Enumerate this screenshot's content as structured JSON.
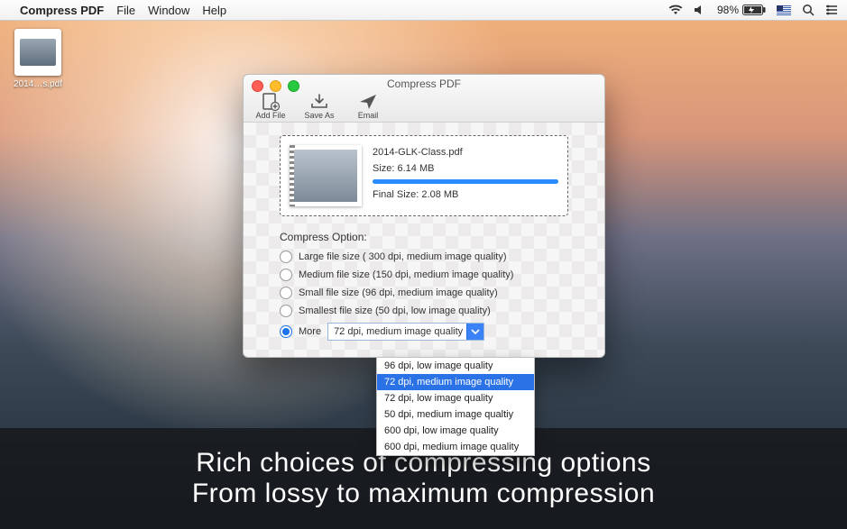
{
  "menubar": {
    "app_name": "Compress PDF",
    "items": [
      "File",
      "Window",
      "Help"
    ],
    "battery_text": "98%"
  },
  "desktop_file": {
    "label": "2014…s.pdf"
  },
  "window": {
    "title": "Compress PDF",
    "toolbar": {
      "add_file": "Add File",
      "save_as": "Save As",
      "email": "Email"
    },
    "card": {
      "filename": "2014-GLK-Class.pdf",
      "size_label": "Size: 6.14 MB",
      "final_size_label": "Final Size: 2.08 MB"
    },
    "compress_section_label": "Compress Option:",
    "options": {
      "large": "Large file size ( 300 dpi, medium image quality)",
      "medium": "Medium file size (150 dpi, medium image quality)",
      "small": "Small file size (96 dpi, medium image quality)",
      "smallest": "Smallest file size (50 dpi, low image quality)",
      "more": "More"
    },
    "combo_value": "72 dpi, medium image quality",
    "dropdown_items": [
      "96 dpi, low image quality",
      "72 dpi, medium image quality",
      "72 dpi, low image quality",
      "50 dpi, medium image qualtiy",
      "600 dpi, low image quality",
      "600 dpi, medium image quality"
    ]
  },
  "caption": {
    "line1": "Rich choices of compressing options",
    "line2": "From lossy to maximum compression"
  },
  "colors": {
    "accent": "#2a72e5"
  }
}
